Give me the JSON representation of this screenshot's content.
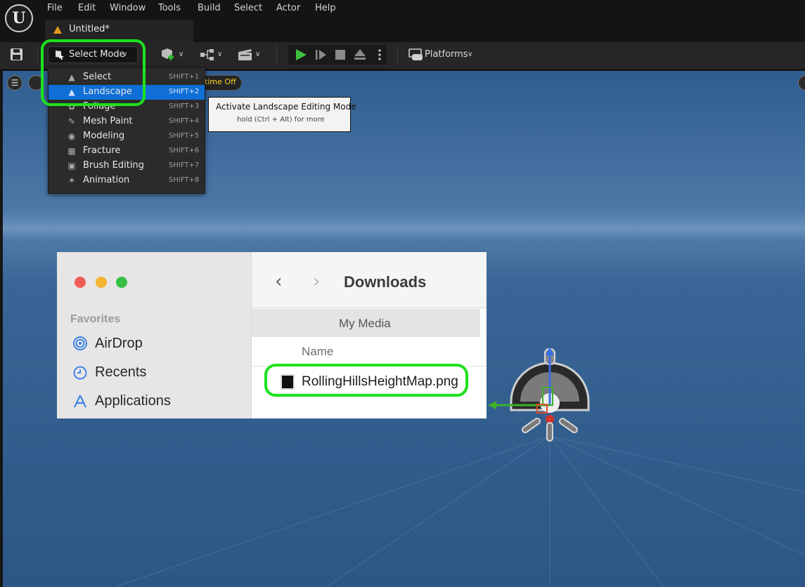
{
  "menubar": {
    "logo": "U",
    "items": [
      "File",
      "Edit",
      "Window",
      "Tools",
      "Build",
      "Select",
      "Actor",
      "Help"
    ]
  },
  "document_tab": {
    "label": "Untitled*"
  },
  "toolbar": {
    "select_mode_label": "Select Mode",
    "platforms_label": "Platforms"
  },
  "viewport": {
    "realtime_label": "ltime Off"
  },
  "mode_menu": {
    "items": [
      {
        "label": "Select",
        "shortcut": "SHIFT+1",
        "icon": "select-mode-icon"
      },
      {
        "label": "Landscape",
        "shortcut": "SHIFT+2",
        "icon": "landscape-mode-icon",
        "active": true
      },
      {
        "label": "Foliage",
        "shortcut": "SHIFT+3",
        "icon": "foliage-mode-icon"
      },
      {
        "label": "Mesh Paint",
        "shortcut": "SHIFT+4",
        "icon": "mesh-paint-icon"
      },
      {
        "label": "Modeling",
        "shortcut": "SHIFT+5",
        "icon": "modeling-icon"
      },
      {
        "label": "Fracture",
        "shortcut": "SHIFT+6",
        "icon": "fracture-icon"
      },
      {
        "label": "Brush Editing",
        "shortcut": "SHIFT+7",
        "icon": "brush-editing-icon"
      },
      {
        "label": "Animation",
        "shortcut": "SHIFT+8",
        "icon": "animation-icon"
      }
    ]
  },
  "tooltip": {
    "title": "Activate Landscape Editing Mode",
    "hint": "hold (Ctrl + Alt) for more"
  },
  "finder": {
    "title": "Downloads",
    "favorites_heading": "Favorites",
    "favorites": [
      {
        "label": "AirDrop",
        "icon": "airdrop-icon"
      },
      {
        "label": "Recents",
        "icon": "recents-icon"
      },
      {
        "label": "Applications",
        "icon": "applications-icon"
      }
    ],
    "tab_label": "My Media",
    "column_name": "Name",
    "file_name": "RollingHillsHeightMap.png"
  },
  "colors": {
    "highlight": "#1de21d",
    "accent": "#0f6fd6",
    "tooltip_title": "#111111"
  }
}
